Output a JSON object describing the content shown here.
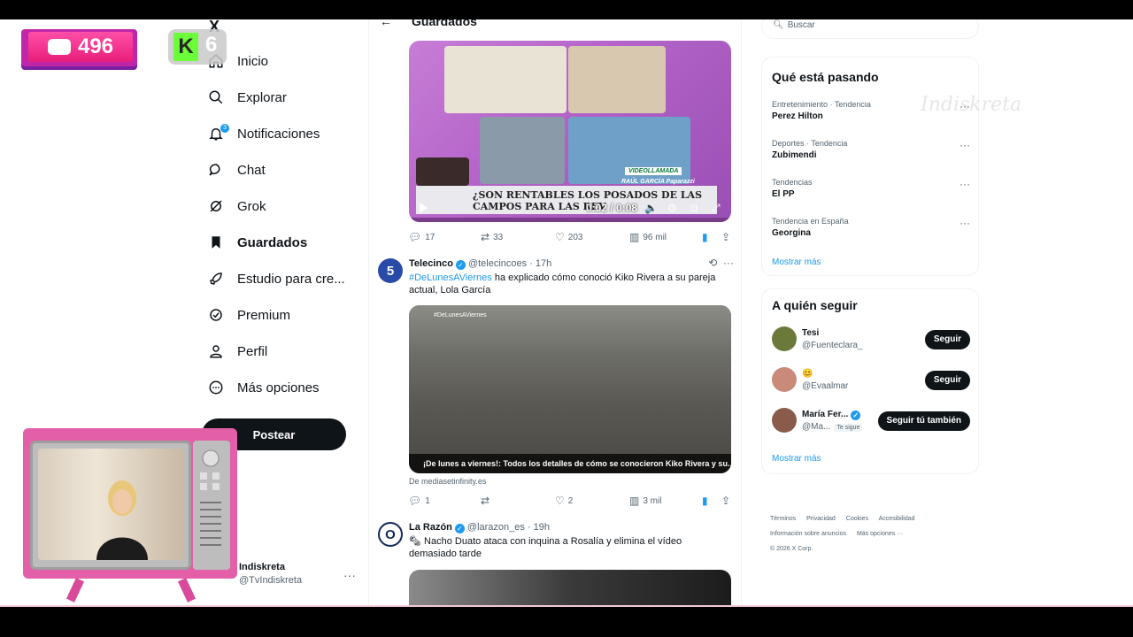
{
  "stream": {
    "chat_count": "496",
    "k_label": "K",
    "k_count": "6",
    "watermark": "Indiskreta"
  },
  "nav": {
    "logo": "X",
    "items": [
      {
        "label": "Inicio",
        "icon": "home-icon"
      },
      {
        "label": "Explorar",
        "icon": "search-icon"
      },
      {
        "label": "Notificaciones",
        "icon": "bell-icon",
        "badge": "3"
      },
      {
        "label": "Chat",
        "icon": "chat-icon"
      },
      {
        "label": "Grok",
        "icon": "grok-icon"
      },
      {
        "label": "Guardados",
        "icon": "bookmark-icon",
        "active": true
      },
      {
        "label": "Estudio para cre...",
        "icon": "rocket-icon"
      },
      {
        "label": "Premium",
        "icon": "premium-icon"
      },
      {
        "label": "Perfil",
        "icon": "person-icon"
      },
      {
        "label": "Más opciones",
        "icon": "more-circle-icon"
      }
    ],
    "post_button": "Postear",
    "profile": {
      "name": "Indiskreta",
      "handle": "@TvIndiskreta",
      "more": "···"
    }
  },
  "center": {
    "title": "Guardados",
    "tweet0": {
      "video_time": "0:02 / 0:08",
      "ticker": "¿SON RENTABLES LOS POSADOS DE LAS CAMPOS PARA LAS REV",
      "badge": "VIDEOLLAMADA",
      "name_tag": "RAÚL GARCÍA Paparazzi",
      "replies": "17",
      "retweets": "33",
      "likes": "203",
      "views": "96 mil"
    },
    "tweet1": {
      "name": "Telecinco",
      "handle": "@telecincoes",
      "time": "17h",
      "hashtag": "#DeLunesAViernes",
      "text": " ha explicado cómo conoció Kiko Rivera a su pareja actual, Lola García",
      "media_tag": "#DeLunesAViernes",
      "caption": "¡De lunes a viernes!: Todos los detalles de cómo se conocieron Kiko Rivera y su...",
      "source": "De mediasetinfinity.es",
      "replies": "1",
      "retweets": "",
      "likes": "2",
      "views": "3 mil"
    },
    "tweet2": {
      "name": "La Razón",
      "handle": "@larazon_es",
      "time": "19h",
      "text": "Nacho Duato ataca con inquina a Rosalía y elimina el vídeo demasiado tarde"
    }
  },
  "right": {
    "search_placeholder": "Buscar",
    "trends_title": "Qué está pasando",
    "trends": [
      {
        "meta": "Entretenimiento · Tendencia",
        "title": "Perez Hilton"
      },
      {
        "meta": "Deportes · Tendencia",
        "title": "Zubimendi"
      },
      {
        "meta": "Tendencias",
        "title": "El PP"
      },
      {
        "meta": "Tendencia en España",
        "title": "Georgina"
      }
    ],
    "trends_more": "Mostrar más",
    "follow_title": "A quién seguir",
    "follow": [
      {
        "name": "Tesi",
        "handle": "@Fuenteclara_",
        "button": "Seguir",
        "color": "#6b7a3a"
      },
      {
        "name": "😊",
        "handle": "@Evaalmar",
        "button": "Seguir",
        "color": "#c98a7a"
      },
      {
        "name": "María Fer...",
        "handle": "@Ma...",
        "tag": "Te sigue",
        "button": "Seguir tú también",
        "color": "#8a5a4a"
      }
    ],
    "follow_more": "Mostrar más",
    "footer": [
      "Términos",
      "Privacidad",
      "Cookies",
      "Accesibilidad",
      "Información sobre anuncios",
      "Más opciones ···",
      "© 2026 X Corp."
    ]
  }
}
